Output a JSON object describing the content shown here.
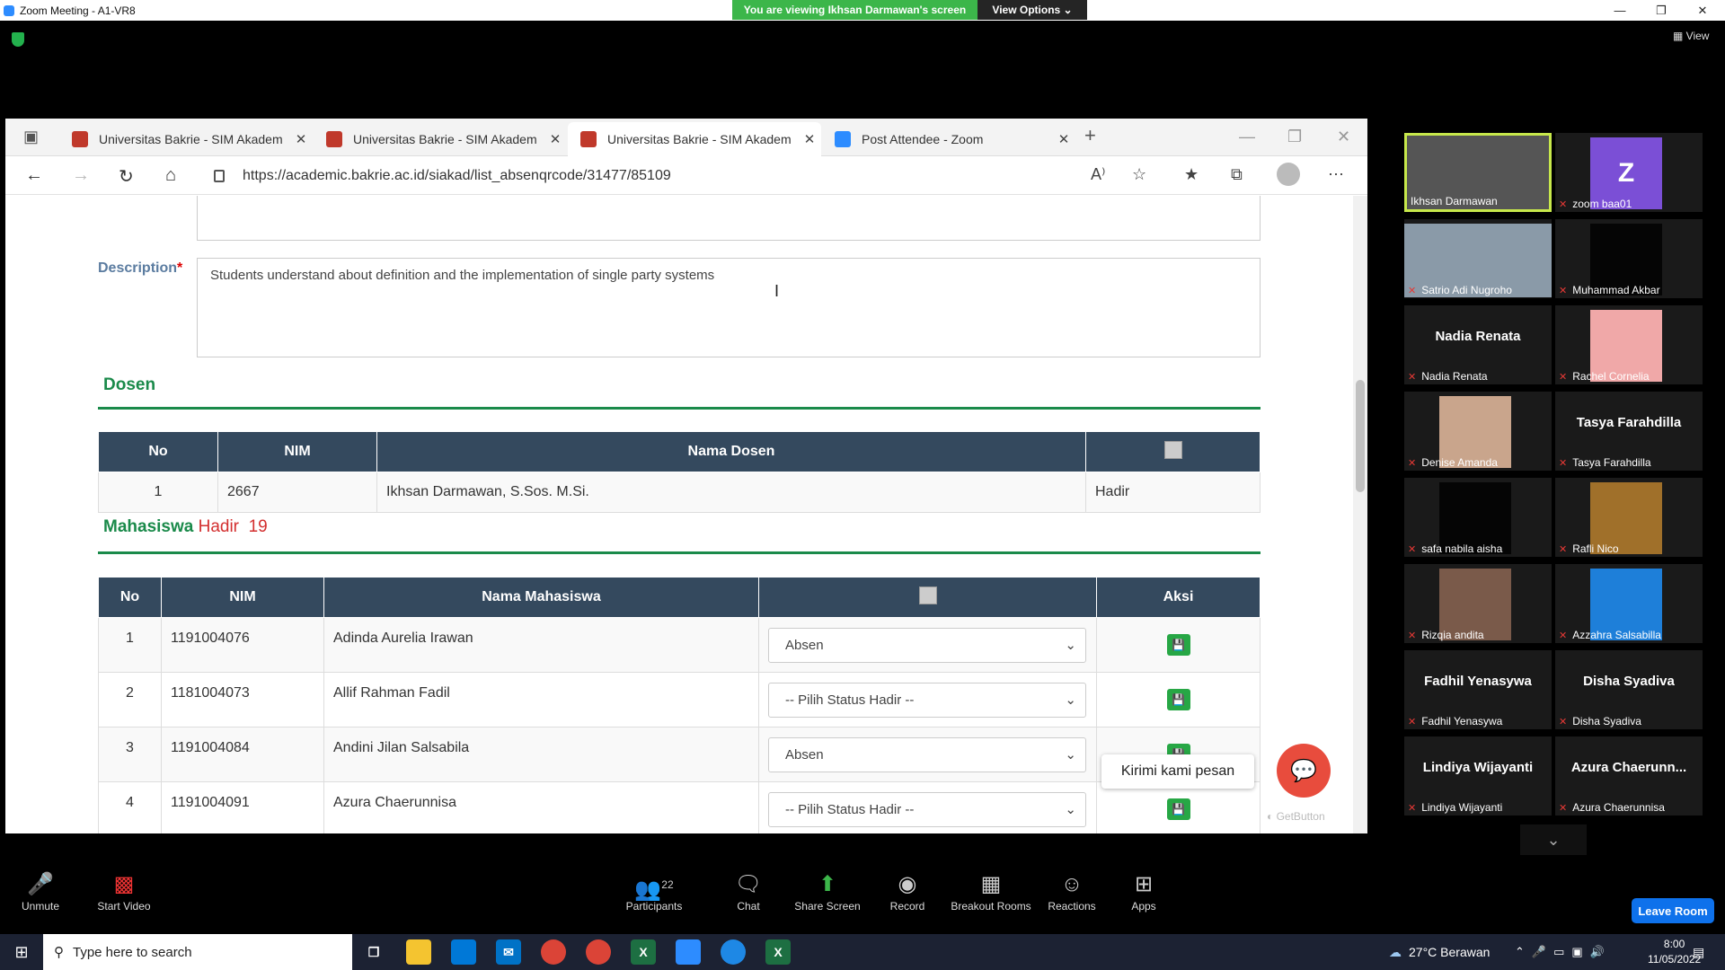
{
  "zoom": {
    "title": "Zoom Meeting - A1-VR8",
    "viewing_banner": "You are viewing Ikhsan Darmawan's screen",
    "view_options": "View Options",
    "view_label": "View",
    "leave": "Leave Room",
    "toolbar": [
      {
        "label": "Unmute",
        "icon": "mic-muted-icon"
      },
      {
        "label": "Start Video",
        "icon": "video-off-icon"
      },
      {
        "label": "Participants",
        "icon": "participants-icon",
        "count": "22"
      },
      {
        "label": "Chat",
        "icon": "chat-icon"
      },
      {
        "label": "Share Screen",
        "icon": "share-screen-icon"
      },
      {
        "label": "Record",
        "icon": "record-icon"
      },
      {
        "label": "Breakout Rooms",
        "icon": "breakout-rooms-icon"
      },
      {
        "label": "Reactions",
        "icon": "reactions-icon"
      },
      {
        "label": "Apps",
        "icon": "apps-icon"
      }
    ],
    "participants": [
      {
        "name": "Ikhsan Darmawan",
        "display": "",
        "type": "video",
        "color": "#555555"
      },
      {
        "name": "zoom baa01",
        "display": "Z",
        "type": "avatar",
        "color": "#7b4fd6"
      },
      {
        "name": "Satrio Adi Nugroho",
        "display": "",
        "type": "video",
        "color": "#8a9aa8"
      },
      {
        "name": "Muhammad Akbar",
        "display": "",
        "type": "video",
        "color": "#050505"
      },
      {
        "name": "Nadia Renata",
        "display": "Nadia Renata",
        "type": "name"
      },
      {
        "name": "Rachel Cornelia",
        "display": "",
        "type": "avatar",
        "color": "#f0a8a8"
      },
      {
        "name": "Denise Amanda",
        "display": "",
        "type": "video",
        "color": "#c9a58c"
      },
      {
        "name": "Tasya Farahdilla",
        "display": "Tasya Farahdilla",
        "type": "name"
      },
      {
        "name": "safa nabila aisha",
        "display": "",
        "type": "video",
        "color": "#050505"
      },
      {
        "name": "Rafli Nico",
        "display": "",
        "type": "video",
        "color": "#a0702a"
      },
      {
        "name": "Rizqia andita",
        "display": "",
        "type": "video",
        "color": "#7a5a4a"
      },
      {
        "name": "Azzahra Salsabilla",
        "display": "",
        "type": "avatar",
        "color": "#1e7fd9"
      },
      {
        "name": "Fadhil Yenasywa",
        "display": "Fadhil Yenasywa",
        "type": "name"
      },
      {
        "name": "Disha Syadiva",
        "display": "Disha Syadiva",
        "type": "name"
      },
      {
        "name": "Lindiya Wijayanti",
        "display": "Lindiya Wijayanti",
        "type": "name"
      },
      {
        "name": "Azura Chaerunnisa",
        "display": "Azura  Chaerunn...",
        "type": "name"
      }
    ]
  },
  "browser": {
    "tabs": [
      {
        "title": "Universitas Bakrie - SIM Akadem",
        "active": false
      },
      {
        "title": "Universitas Bakrie - SIM Akadem",
        "active": false
      },
      {
        "title": "Universitas Bakrie - SIM Akadem",
        "active": true
      },
      {
        "title": "Post Attendee - Zoom",
        "active": false
      }
    ],
    "url": "https://academic.bakrie.ac.id/siakad/list_absenqrcode/31477/85109"
  },
  "page": {
    "description_label": "Description",
    "description_required": "*",
    "description_value": "Students understand about definition and the implementation of single party systems",
    "dosen_title": "Dosen",
    "dosen_headers": [
      "No",
      "NIM",
      "Nama Dosen"
    ],
    "dosen_rows": [
      {
        "no": "1",
        "nim": "2667",
        "nama": "Ikhsan Darmawan, S.Sos. M.Si.",
        "status": "Hadir"
      }
    ],
    "mahasiswa_title": "Mahasiswa",
    "hadir_label": "Hadir",
    "hadir_count": "19",
    "mhs_headers": [
      "No",
      "NIM",
      "Nama Mahasiswa",
      "Aksi"
    ],
    "mhs_rows": [
      {
        "no": "1",
        "nim": "1191004076",
        "nama": "Adinda Aurelia Irawan",
        "status": "Absen"
      },
      {
        "no": "2",
        "nim": "1181004073",
        "nama": "Allif Rahman Fadil",
        "status": "-- Pilih Status Hadir --"
      },
      {
        "no": "3",
        "nim": "1191004084",
        "nama": "Andini Jilan Salsabila",
        "status": "Absen"
      },
      {
        "no": "4",
        "nim": "1191004091",
        "nama": "Azura Chaerunnisa",
        "status": "-- Pilih Status Hadir --"
      }
    ],
    "chat_tooltip": "Kirimi kami pesan",
    "getbutton": "GetButton"
  },
  "taskbar": {
    "search_placeholder": "Type here to search",
    "weather": "27°C  Berawan",
    "time": "8:00",
    "date": "11/05/2022"
  }
}
